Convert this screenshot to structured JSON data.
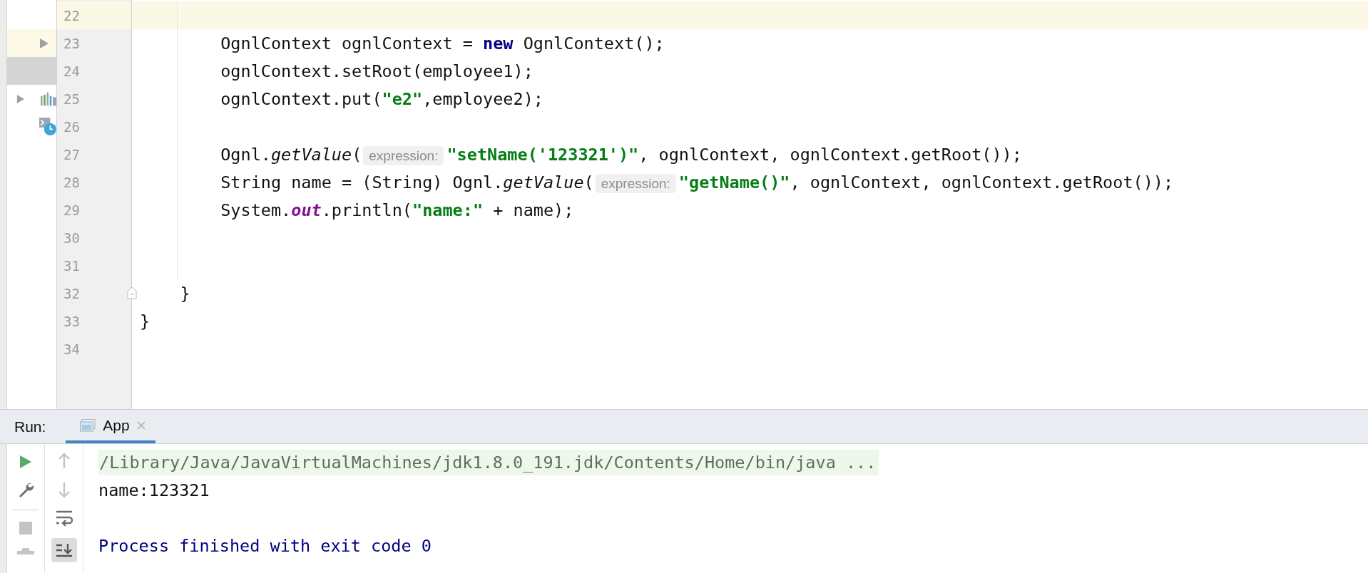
{
  "editor": {
    "lines": [
      {
        "number": "22",
        "current": true,
        "fold_marker": false
      },
      {
        "number": "23",
        "current": false,
        "fold_marker": false,
        "tokens": [
          {
            "kind": "plain",
            "text": "        OgnlContext ognlContext = "
          },
          {
            "kind": "keyword",
            "text": "new"
          },
          {
            "kind": "plain",
            "text": " OgnlContext();"
          }
        ]
      },
      {
        "number": "24",
        "current": false,
        "fold_marker": false,
        "tokens": [
          {
            "kind": "plain",
            "text": "        ognlContext.setRoot(employee1);"
          }
        ]
      },
      {
        "number": "25",
        "current": false,
        "fold_marker": false,
        "tokens": [
          {
            "kind": "plain",
            "text": "        ognlContext.put("
          },
          {
            "kind": "string",
            "text": "\"e2\""
          },
          {
            "kind": "plain",
            "text": ",employee2);"
          }
        ]
      },
      {
        "number": "26",
        "current": false,
        "fold_marker": false
      },
      {
        "number": "27",
        "current": false,
        "fold_marker": false,
        "tokens": [
          {
            "kind": "plain",
            "text": "        Ognl."
          },
          {
            "kind": "method",
            "text": "getValue"
          },
          {
            "kind": "plain",
            "text": "("
          },
          {
            "kind": "hint",
            "text": "expression:"
          },
          {
            "kind": "string",
            "text": "\"setName('123321')\""
          },
          {
            "kind": "plain",
            "text": ", ognlContext, ognlContext.getRoot());"
          }
        ]
      },
      {
        "number": "28",
        "current": false,
        "fold_marker": false,
        "tokens": [
          {
            "kind": "plain",
            "text": "        String name = (String) Ognl."
          },
          {
            "kind": "method",
            "text": "getValue"
          },
          {
            "kind": "plain",
            "text": "("
          },
          {
            "kind": "hint",
            "text": "expression:"
          },
          {
            "kind": "string",
            "text": "\"getName()\""
          },
          {
            "kind": "plain",
            "text": ", ognlContext, ognlContext.getRoot());"
          }
        ]
      },
      {
        "number": "29",
        "current": false,
        "fold_marker": false,
        "tokens": [
          {
            "kind": "plain",
            "text": "        System."
          },
          {
            "kind": "field",
            "text": "out"
          },
          {
            "kind": "plain",
            "text": ".println("
          },
          {
            "kind": "string",
            "text": "\"name:\""
          },
          {
            "kind": "plain",
            "text": " + name);"
          }
        ]
      },
      {
        "number": "30",
        "current": false,
        "fold_marker": false
      },
      {
        "number": "31",
        "current": false,
        "fold_marker": false
      },
      {
        "number": "32",
        "current": false,
        "fold_marker": true,
        "tokens": [
          {
            "kind": "plain",
            "text": "    }"
          }
        ]
      },
      {
        "number": "33",
        "current": false,
        "fold_marker": false,
        "tokens": [
          {
            "kind": "plain",
            "text": "}"
          }
        ]
      },
      {
        "number": "34",
        "current": false,
        "fold_marker": false
      }
    ]
  },
  "run_panel": {
    "label": "Run:",
    "tabs": [
      {
        "label": "App",
        "selected": true
      }
    ],
    "output": [
      {
        "kind": "command",
        "text": "/Library/Java/JavaVirtualMachines/jdk1.8.0_191.jdk/Contents/Home/bin/java ..."
      },
      {
        "kind": "stdout",
        "text": "name:123321"
      },
      {
        "kind": "blank"
      },
      {
        "kind": "system",
        "text": "Process finished with exit code 0"
      }
    ]
  }
}
